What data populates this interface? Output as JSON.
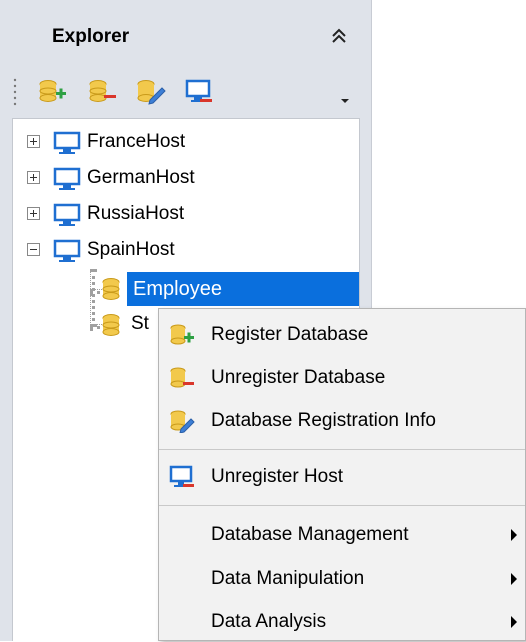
{
  "explorer": {
    "title": "Explorer",
    "toolbar": {
      "register_db": "register-database-icon",
      "unregister_db": "unregister-database-icon",
      "db_info": "database-registration-info-icon",
      "unregister_host": "unregister-host-icon"
    },
    "tree": {
      "hosts": [
        {
          "label": "FranceHost",
          "expanded": false
        },
        {
          "label": "GermanHost",
          "expanded": false
        },
        {
          "label": "RussiaHost",
          "expanded": false
        },
        {
          "label": "SpainHost",
          "expanded": true
        }
      ],
      "children": [
        {
          "label": "Employee",
          "selected": true
        },
        {
          "label": "St",
          "selected": false
        }
      ]
    }
  },
  "context_menu": {
    "items": [
      {
        "label": "Register Database",
        "icon": "register-database-icon"
      },
      {
        "label": "Unregister Database",
        "icon": "unregister-database-icon"
      },
      {
        "label": "Database Registration Info",
        "icon": "database-registration-info-icon"
      },
      {
        "label": "Unregister Host",
        "icon": "unregister-host-icon"
      },
      {
        "label": "Database Management",
        "submenu": true
      },
      {
        "label": "Data Manipulation",
        "submenu": true
      },
      {
        "label": "Data Analysis",
        "submenu": true
      }
    ]
  },
  "colors": {
    "panel_bg": "#dfe3ea",
    "selection": "#0a6fdd",
    "db_yellow": "#f2c94c",
    "host_blue": "#1f6fd1",
    "plus_green": "#2ea043",
    "minus_red": "#d9362b"
  }
}
